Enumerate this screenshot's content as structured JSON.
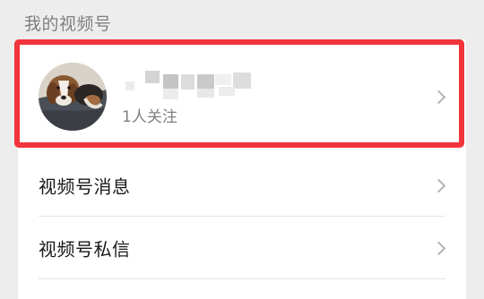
{
  "section": {
    "title": "我的视频号"
  },
  "profile": {
    "followers": "1人关注",
    "accent": "#f2353b"
  },
  "menu": {
    "items": [
      {
        "label": "视频号消息",
        "icon": "chevron-right-icon"
      },
      {
        "label": "视频号私信",
        "icon": "chevron-right-icon"
      }
    ]
  }
}
